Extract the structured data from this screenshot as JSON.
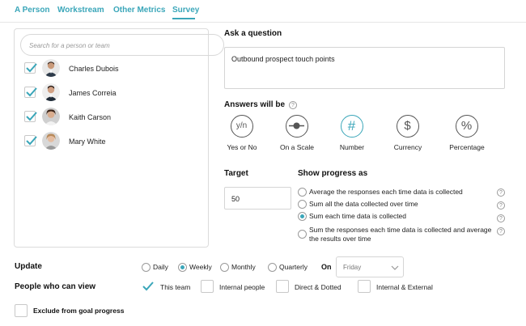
{
  "tabs": [
    {
      "label": "A Person"
    },
    {
      "label": "Workstream"
    },
    {
      "label": "Other Metrics"
    },
    {
      "label": "Survey"
    }
  ],
  "search": {
    "placeholder": "Search for a person or team"
  },
  "people": [
    {
      "name": "Charles Dubois",
      "checked": true
    },
    {
      "name": "James Correia",
      "checked": true
    },
    {
      "name": "Kaith Carson",
      "checked": true
    },
    {
      "name": "Mary White",
      "checked": true
    }
  ],
  "question": {
    "label": "Ask a question",
    "value": "Outbound prospect touch points"
  },
  "answers": {
    "label": "Answers will be",
    "help": "?",
    "options": [
      {
        "label": "Yes or No",
        "icon": "yes-no-icon",
        "glyph": "y/n"
      },
      {
        "label": "On a Scale",
        "icon": "scale-icon"
      },
      {
        "label": "Number",
        "icon": "hash-icon",
        "glyph": "#",
        "selected": true
      },
      {
        "label": "Currency",
        "icon": "dollar-icon",
        "glyph": "$"
      },
      {
        "label": "Percentage",
        "icon": "percent-icon",
        "glyph": "%"
      }
    ]
  },
  "target": {
    "label": "Target",
    "value": "50"
  },
  "progress": {
    "label": "Show progress as",
    "options": [
      {
        "text": "Average the responses each time data is collected",
        "selected": false
      },
      {
        "text": "Sum all the data collected over time",
        "selected": false
      },
      {
        "text": "Sum each time data is collected",
        "selected": true
      },
      {
        "text": "Sum the responses each time data is collected and average the results over time",
        "selected": false
      }
    ]
  },
  "update": {
    "label": "Update",
    "options": [
      {
        "label": "Daily",
        "selected": false
      },
      {
        "label": "Weekly",
        "selected": true
      },
      {
        "label": "Monthly",
        "selected": false
      },
      {
        "label": "Quarterly",
        "selected": false
      }
    ],
    "on_label": "On",
    "day": "Friday"
  },
  "viewers": {
    "label": "People who can view",
    "options": [
      {
        "label": "This team",
        "checked": true
      },
      {
        "label": "Internal people",
        "checked": false
      },
      {
        "label": "Direct & Dotted",
        "checked": false
      },
      {
        "label": "Internal & External",
        "checked": false
      }
    ]
  },
  "exclude": {
    "label": "Exclude from goal progress",
    "checked": false
  },
  "colors": {
    "accent": "#3aa6b9",
    "border": "#d5d5d5",
    "text": "#222222"
  }
}
